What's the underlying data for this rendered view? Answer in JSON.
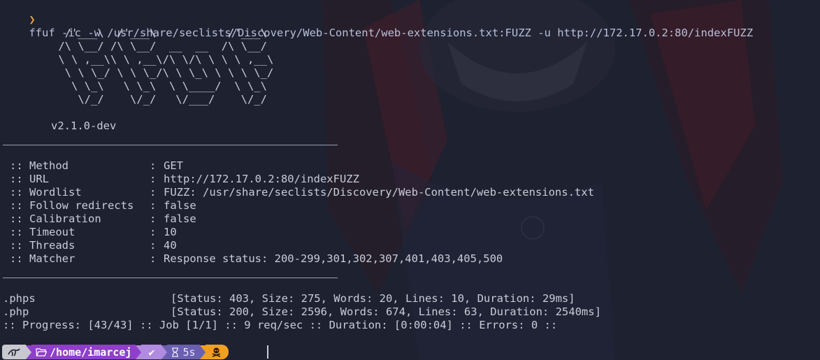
{
  "command": {
    "prompt_symbol": "❯",
    "text": "ffuf -ic -w /usr/share/seclists/Discovery/Web-Content/web-extensions.txt:FUZZ -u http://172.17.0.2:80/indexFUZZ"
  },
  "banner": {
    "ascii": "  /'___\\  /'___\\           /'___\\\n /\\ \\__/ /\\ \\__/  __  __  /\\ \\__/\n \\ \\ ,__\\\\ \\ ,__\\/\\ \\/\\ \\ \\ \\ ,__\\\n  \\ \\ \\_/ \\ \\ \\_/\\ \\ \\_\\ \\ \\ \\ \\_/\n   \\ \\_\\   \\ \\_\\  \\ \\____/  \\ \\_\\\n    \\/_/    \\/_/   \\/___/    \\/_/",
    "version": "v2.1.0-dev"
  },
  "config": [
    {
      "key": ":: Method",
      "value": "GET"
    },
    {
      "key": ":: URL",
      "value": "http://172.17.0.2:80/indexFUZZ"
    },
    {
      "key": ":: Wordlist",
      "value": "FUZZ: /usr/share/seclists/Discovery/Web-Content/web-extensions.txt"
    },
    {
      "key": ":: Follow redirects",
      "value": "false"
    },
    {
      "key": ":: Calibration",
      "value": "false"
    },
    {
      "key": ":: Timeout",
      "value": "10"
    },
    {
      "key": ":: Threads",
      "value": "40"
    },
    {
      "key": ":: Matcher",
      "value": "Response status: 200-299,301,302,307,401,403,405,500"
    }
  ],
  "separator": ":",
  "results": [
    {
      "word": ".phps",
      "info": "[Status: 403, Size: 275, Words: 20, Lines: 10, Duration: 29ms]"
    },
    {
      "word": ".php",
      "info": "[Status: 200, Size: 2596, Words: 674, Lines: 63, Duration: 2540ms]"
    }
  ],
  "progress": ":: Progress: [43/43] :: Job [1/1] :: 9 req/sec :: Duration: [0:00:04] :: Errors: 0 ::",
  "statusbar": {
    "os_icon": "kali-dragon-icon",
    "folder_icon": "folder-open-icon",
    "path": "/home/imarcej",
    "ok_symbol": "✔",
    "timer_icon": "hourglass-icon",
    "duration": "5s",
    "root_icon": "skull-crossbones-icon"
  },
  "colors": {
    "background": "#1e2130",
    "prompt_accent": "#e0a040",
    "segment_path": "#8f3fc9",
    "segment_ok": "#b18be0",
    "segment_time": "#6a5fb0",
    "segment_root": "#f0a020"
  }
}
